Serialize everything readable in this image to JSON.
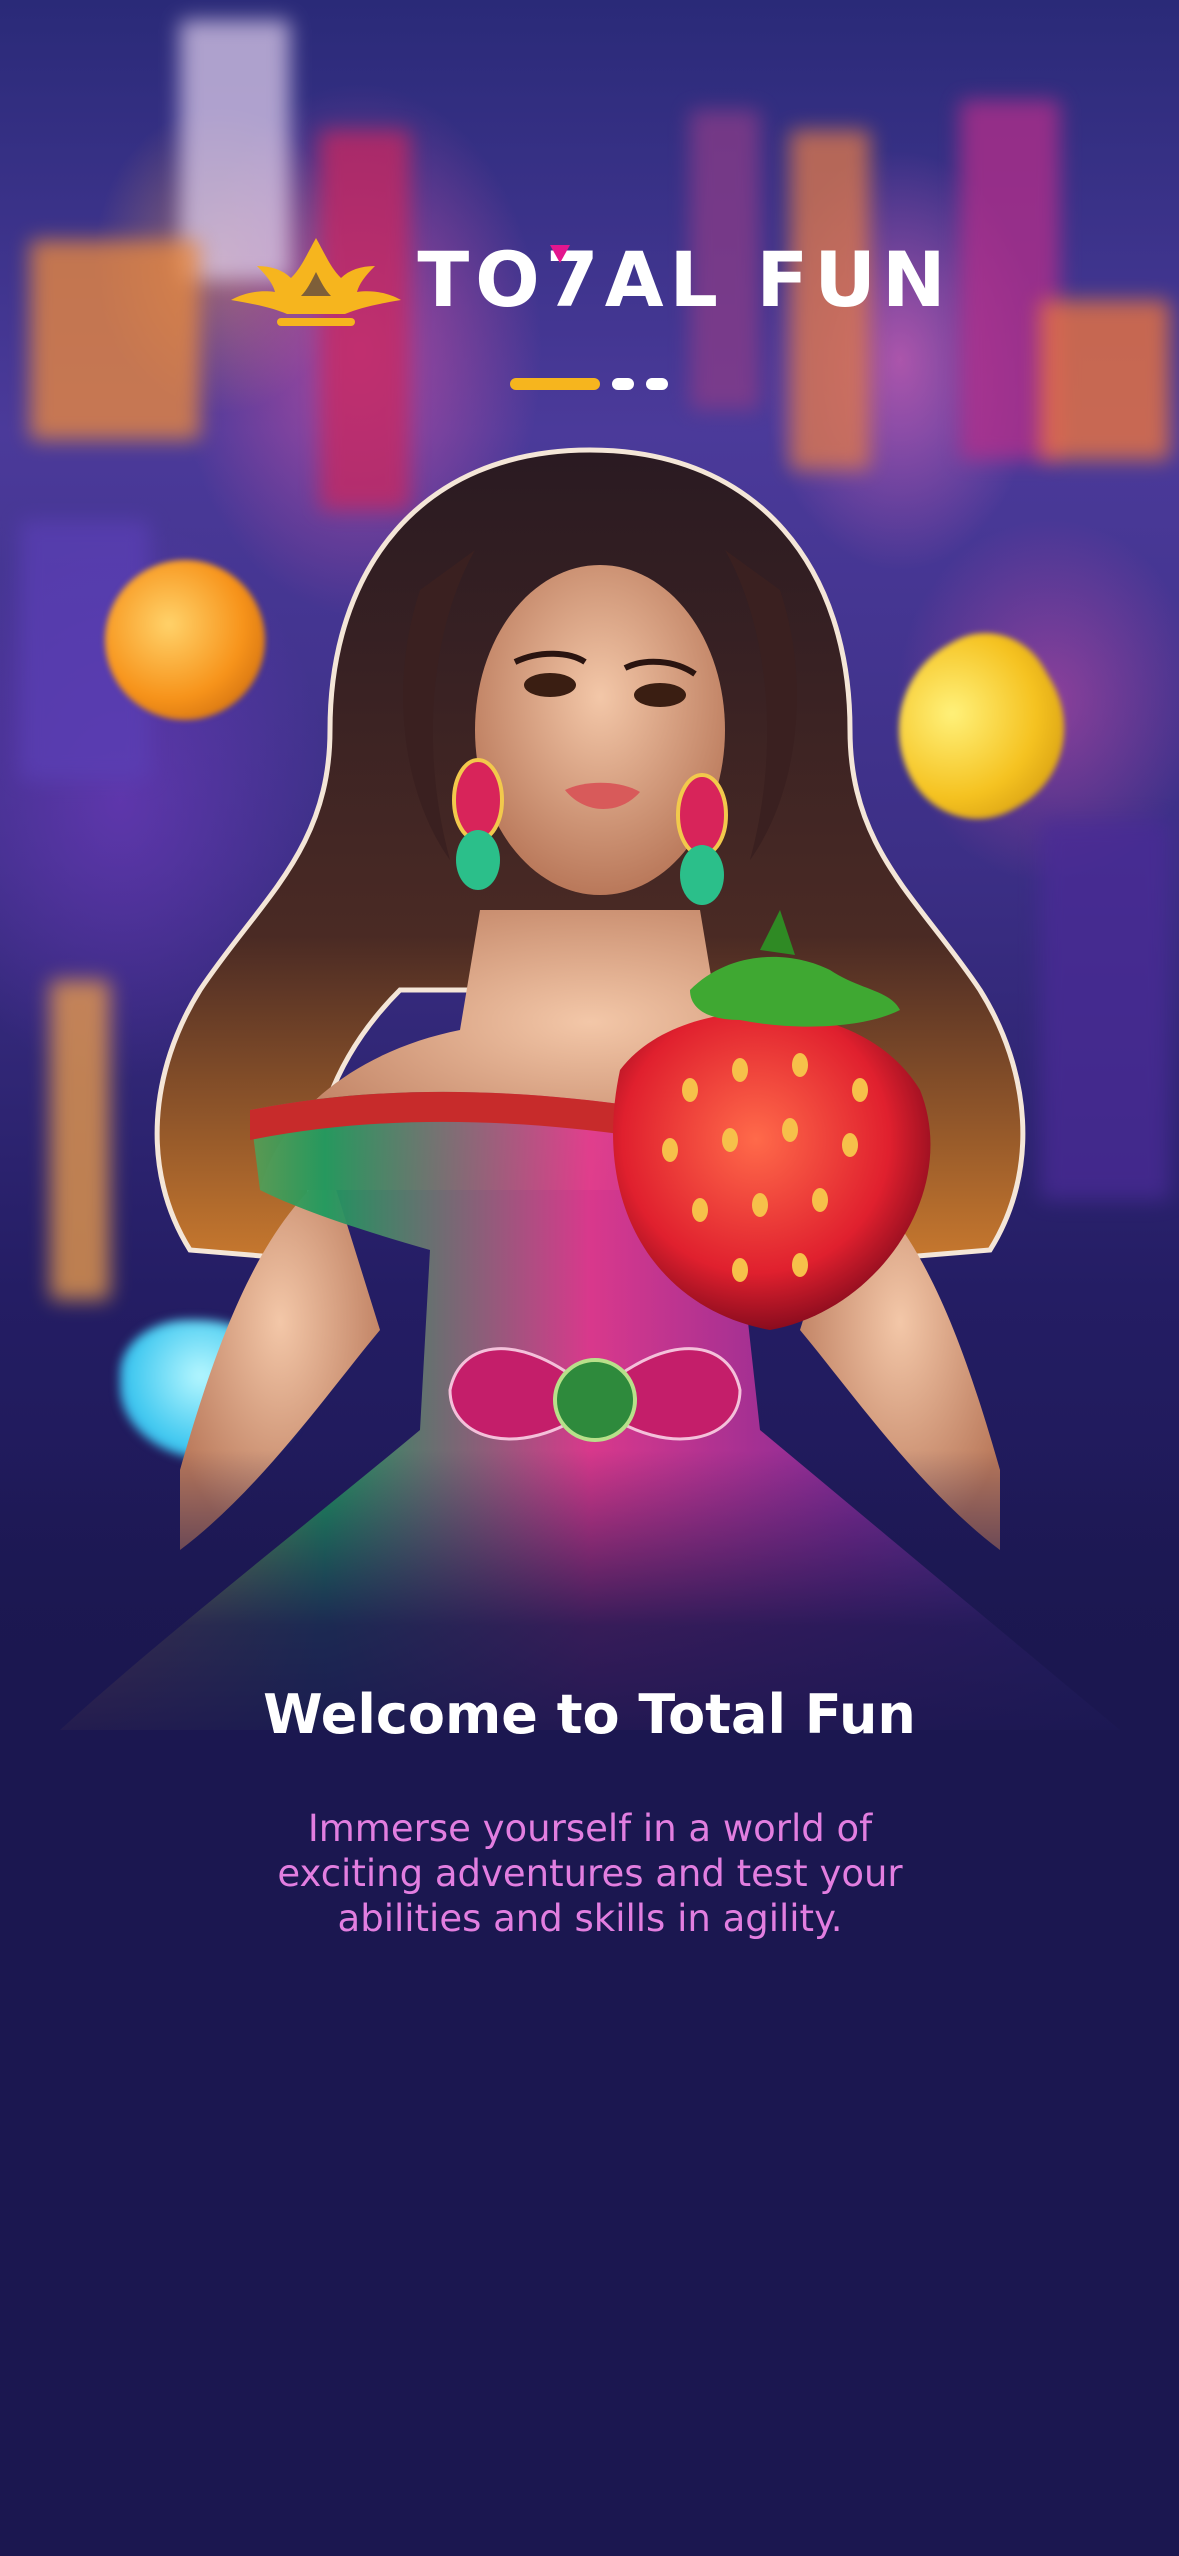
{
  "app": {
    "brand_name": "TO7AL FUN",
    "brand_name_part1": "TO",
    "brand_name_part2": "7",
    "brand_name_part3": "AL FUN",
    "logo_icon": "crown-icon"
  },
  "onboarding": {
    "page_indicator": {
      "total_pages": 3,
      "current_page": 1
    },
    "hero_image": "woman-with-strawberry-illustration",
    "title": "Welcome to Total Fun",
    "subtitle_lines": [
      "Immerse yourself in a world of",
      "exciting adventures and test your",
      "abilities and skills in agility."
    ]
  },
  "colors": {
    "background": "#1b1750",
    "accent_gold": "#f6b51e",
    "subtitle_pink": "#e27ee0",
    "brand_accent_magenta": "#e3168e",
    "text_white": "#ffffff"
  }
}
